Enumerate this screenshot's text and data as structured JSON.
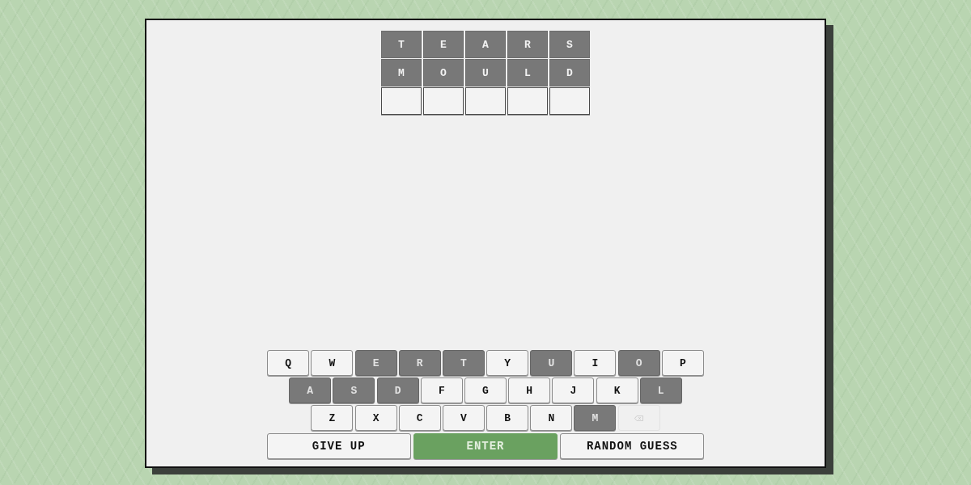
{
  "board": {
    "rows": [
      {
        "tiles": [
          {
            "kind": "letter",
            "letter": "T"
          },
          {
            "kind": "letter",
            "letter": "E"
          },
          {
            "kind": "letter",
            "letter": "A"
          },
          {
            "kind": "letter",
            "letter": "R"
          },
          {
            "kind": "letter",
            "letter": "S"
          }
        ]
      },
      {
        "tiles": [
          {
            "kind": "letter",
            "letter": "M"
          },
          {
            "kind": "letter",
            "letter": "O"
          },
          {
            "kind": "letter",
            "letter": "U"
          },
          {
            "kind": "letter",
            "letter": "L"
          },
          {
            "kind": "letter",
            "letter": "D"
          }
        ]
      },
      {
        "tiles": [
          {
            "kind": "empty"
          },
          {
            "kind": "empty"
          },
          {
            "kind": "empty"
          },
          {
            "kind": "empty"
          },
          {
            "kind": "empty"
          }
        ]
      }
    ]
  },
  "keyboard": {
    "rows": [
      {
        "keys": [
          {
            "kind": "letter",
            "label": "Q",
            "used": false
          },
          {
            "kind": "letter",
            "label": "W",
            "used": false
          },
          {
            "kind": "letter",
            "label": "E",
            "used": true
          },
          {
            "kind": "letter",
            "label": "R",
            "used": true
          },
          {
            "kind": "letter",
            "label": "T",
            "used": true
          },
          {
            "kind": "letter",
            "label": "Y",
            "used": false
          },
          {
            "kind": "letter",
            "label": "U",
            "used": true
          },
          {
            "kind": "letter",
            "label": "I",
            "used": false
          },
          {
            "kind": "letter",
            "label": "O",
            "used": true
          },
          {
            "kind": "letter",
            "label": "P",
            "used": false
          }
        ]
      },
      {
        "keys": [
          {
            "kind": "letter",
            "label": "A",
            "used": true
          },
          {
            "kind": "letter",
            "label": "S",
            "used": true
          },
          {
            "kind": "letter",
            "label": "D",
            "used": true
          },
          {
            "kind": "letter",
            "label": "F",
            "used": false
          },
          {
            "kind": "letter",
            "label": "G",
            "used": false
          },
          {
            "kind": "letter",
            "label": "H",
            "used": false
          },
          {
            "kind": "letter",
            "label": "J",
            "used": false
          },
          {
            "kind": "letter",
            "label": "K",
            "used": false
          },
          {
            "kind": "letter",
            "label": "L",
            "used": true
          }
        ]
      },
      {
        "keys": [
          {
            "kind": "letter",
            "label": "Z",
            "used": false
          },
          {
            "kind": "letter",
            "label": "X",
            "used": false
          },
          {
            "kind": "letter",
            "label": "C",
            "used": false
          },
          {
            "kind": "letter",
            "label": "V",
            "used": false
          },
          {
            "kind": "letter",
            "label": "B",
            "used": false
          },
          {
            "kind": "letter",
            "label": "N",
            "used": false
          },
          {
            "kind": "letter",
            "label": "M",
            "used": true
          },
          {
            "kind": "backspace",
            "disabled": true
          }
        ]
      }
    ],
    "actions": [
      {
        "label": "GIVE UP",
        "kind": "secondary"
      },
      {
        "label": "ENTER",
        "kind": "primary"
      },
      {
        "label": "RANDOM GUESS",
        "kind": "secondary"
      }
    ]
  }
}
